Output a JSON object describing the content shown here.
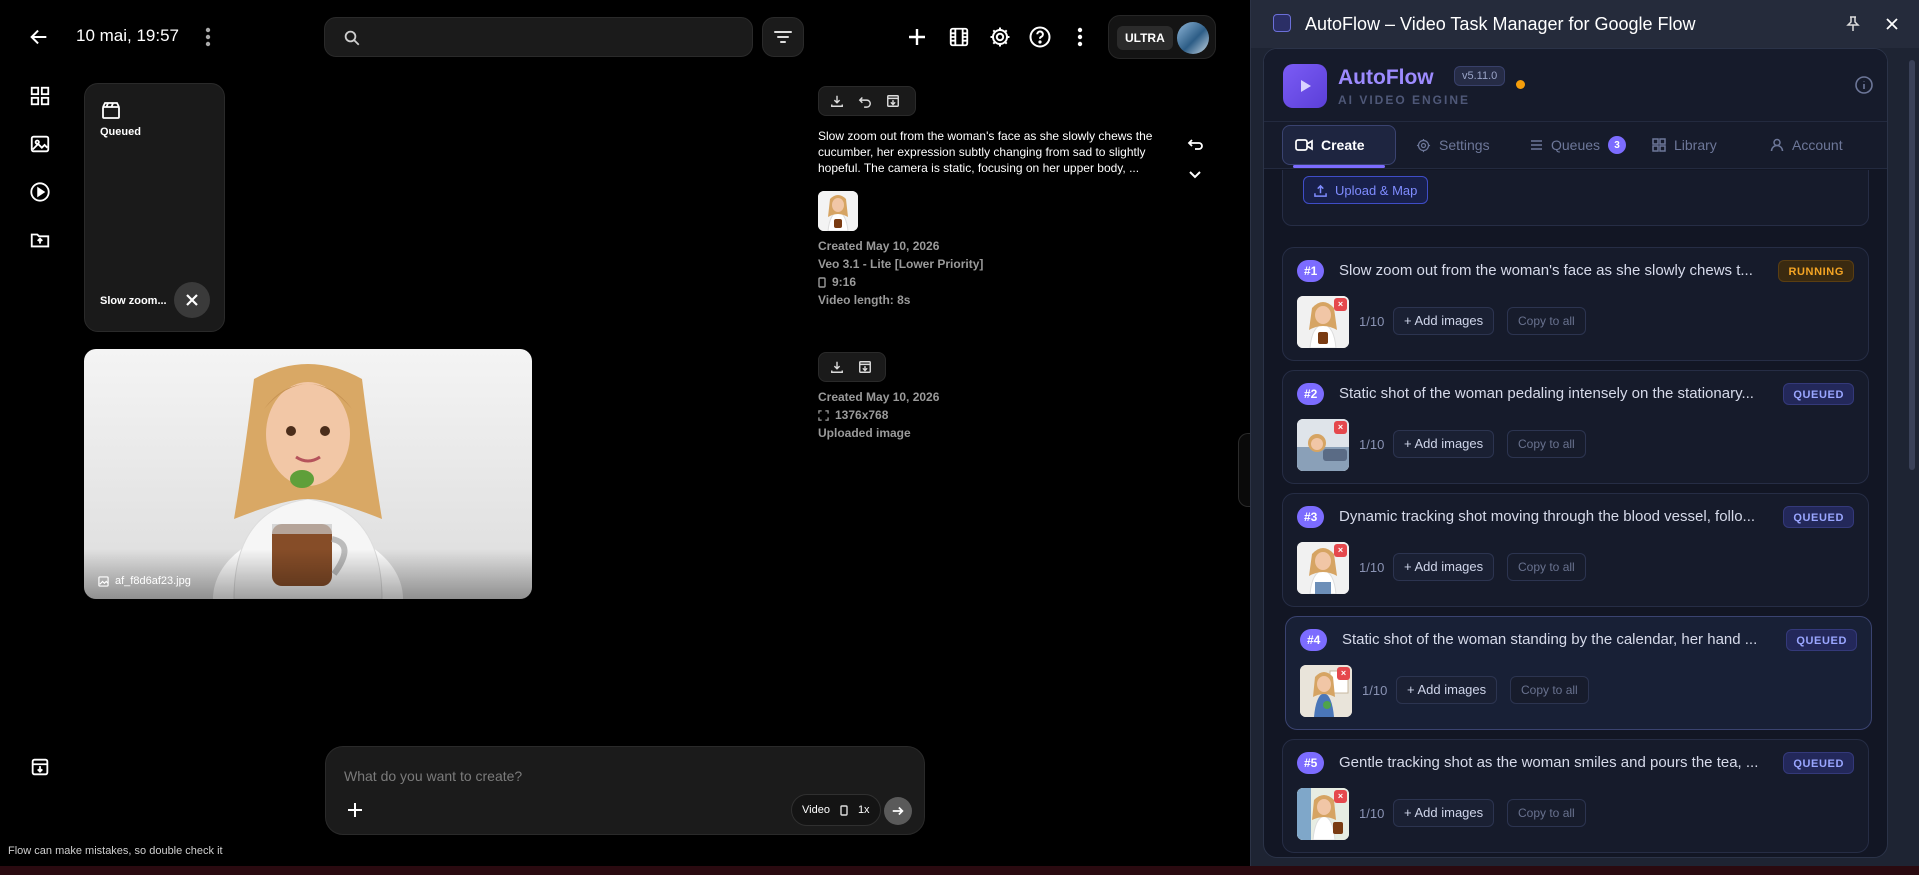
{
  "flow": {
    "date": "10 mai, 19:57",
    "search_placeholder": "",
    "plan_badge": "ULTRA",
    "queued_card": {
      "status": "Queued",
      "title": "Slow zoom..."
    },
    "image_card": {
      "filename": "af_f8d6af23.jpg"
    },
    "video_item": {
      "description": "Slow zoom out from the woman's face as she slowly chews the cucumber, her expression subtly changing from sad to slightly hopeful. The camera is static, focusing on her upper body, ...",
      "created": "Created May 10, 2026",
      "model": "Veo 3.1 - Lite [Lower Priority]",
      "aspect": "9:16",
      "length": "Video length: 8s"
    },
    "image_item": {
      "created": "Created May 10, 2026",
      "size": "1376x768",
      "type": "Uploaded image"
    },
    "composer": {
      "placeholder": "What do you want to create?",
      "mode": "Video",
      "multiplier": "1x"
    },
    "footnote": "Flow can make mistakes, so double check it"
  },
  "panel": {
    "window_title": "AutoFlow – Video Task Manager for Google Flow",
    "brand": "AutoFlow",
    "version": "v5.11.0",
    "subtitle": "AI VIDEO ENGINE",
    "tabs": [
      {
        "label": "Create"
      },
      {
        "label": "Settings"
      },
      {
        "label": "Queues",
        "count": "3"
      },
      {
        "label": "Library"
      },
      {
        "label": "Account"
      }
    ],
    "upload_label": "Upload & Map",
    "add_images_label": "+ Add images",
    "copy_label": "Copy to all",
    "queue": [
      {
        "num": "#1",
        "text": "Slow zoom out from the woman's face as she slowly chews t...",
        "status": "RUNNING",
        "count": "1/10"
      },
      {
        "num": "#2",
        "text": "Static shot of the woman pedaling intensely on the stationary...",
        "status": "QUEUED",
        "count": "1/10"
      },
      {
        "num": "#3",
        "text": "Dynamic tracking shot moving through the blood vessel, follo...",
        "status": "QUEUED",
        "count": "1/10"
      },
      {
        "num": "#4",
        "text": "Static shot of the woman standing by the calendar, her hand ...",
        "status": "QUEUED",
        "count": "1/10"
      },
      {
        "num": "#5",
        "text": "Gentle tracking shot as the woman smiles and pours the tea, ...",
        "status": "QUEUED",
        "count": "1/10"
      }
    ],
    "colors": {
      "accent": "#7c6cff",
      "running": "#f5a524",
      "queued": "#9aa6ff",
      "remove": "#e5484d"
    }
  }
}
